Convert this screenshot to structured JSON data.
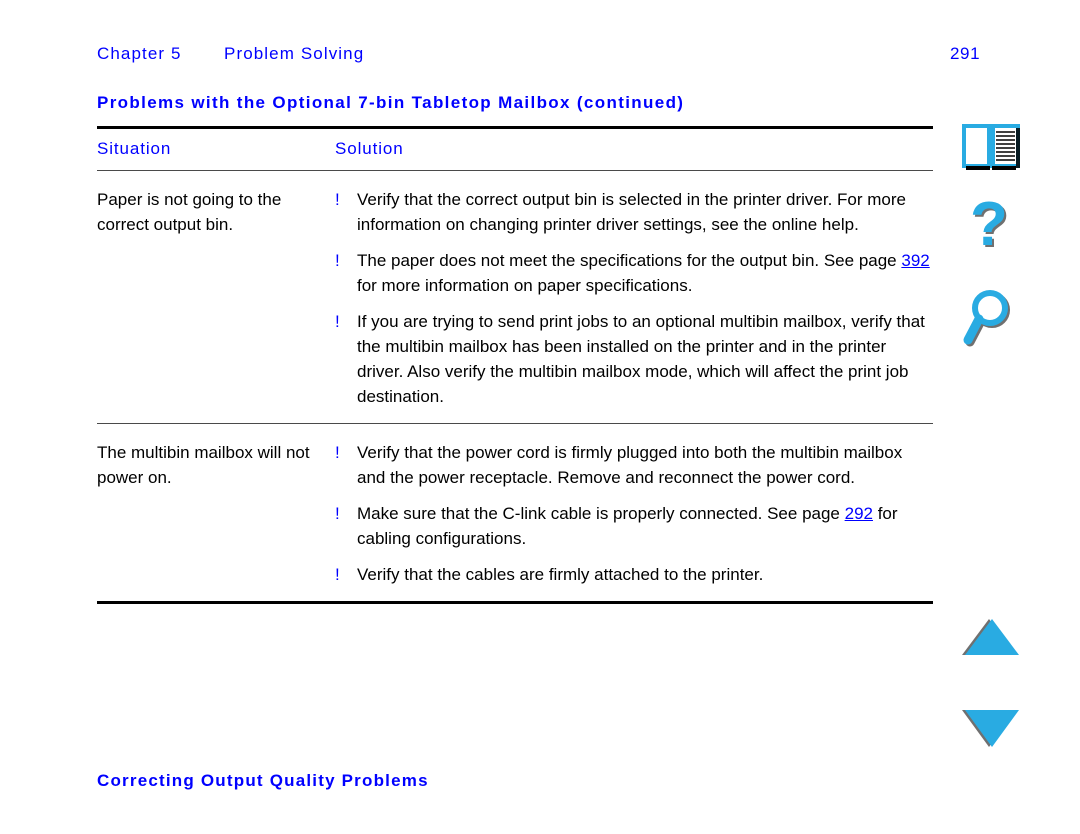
{
  "header": {
    "chapter_label": "Chapter 5",
    "chapter_title": "Problem Solving",
    "page_number": "291"
  },
  "table": {
    "title": "Problems with the Optional 7-bin Tabletop Mailbox (continued)",
    "columns": [
      "Situation",
      "Solution"
    ],
    "rows": [
      {
        "situation": "Paper is not going to the correct output bin.",
        "solutions": [
          {
            "bullet": "!",
            "parts": [
              {
                "type": "text",
                "value": "Verify that the correct output bin is selected in the printer driver. For more information on changing printer driver settings, see the online help."
              }
            ]
          },
          {
            "bullet": "!",
            "parts": [
              {
                "type": "text",
                "value": "The paper does not meet the specifications for the output bin. See page "
              },
              {
                "type": "xref",
                "value": "392"
              },
              {
                "type": "text",
                "value": " for more information on paper specifications."
              }
            ]
          },
          {
            "bullet": "!",
            "parts": [
              {
                "type": "text",
                "value": "If you are trying to send print jobs to an optional multibin mailbox, verify that the multibin mailbox has been installed on the printer and in the printer driver. Also verify the multibin mailbox mode, which will affect the print job destination."
              }
            ]
          }
        ]
      },
      {
        "situation": "The multibin mailbox will not power on.",
        "solutions": [
          {
            "bullet": "!",
            "parts": [
              {
                "type": "text",
                "value": "Verify that the power cord is firmly plugged into both the multibin mailbox and the power receptacle. Remove and reconnect the power cord."
              }
            ]
          },
          {
            "bullet": "!",
            "parts": [
              {
                "type": "text",
                "value": "Make sure that the C-link cable is properly connected. See page "
              },
              {
                "type": "xref",
                "value": "292"
              },
              {
                "type": "text",
                "value": " for cabling configurations."
              }
            ]
          },
          {
            "bullet": "!",
            "parts": [
              {
                "type": "text",
                "value": "Verify that the cables are firmly attached to the printer."
              }
            ]
          }
        ]
      }
    ]
  },
  "footer": {
    "link_label": "Correcting Output Quality Problems"
  },
  "iconrail": {
    "items": [
      {
        "name": "book-icon",
        "tooltip": "Table of Contents"
      },
      {
        "name": "question-mark-icon",
        "tooltip": "Help"
      },
      {
        "name": "magnifier-icon",
        "tooltip": "Find"
      },
      {
        "name": "triangle-up-icon",
        "tooltip": "Previous page"
      },
      {
        "name": "triangle-down-icon",
        "tooltip": "Next page"
      }
    ]
  },
  "colors": {
    "link_blue": "#0000FF",
    "icon_cyan": "#29ABE2",
    "icon_shadow": "#707070",
    "rule_black": "#000000",
    "text_black": "#000000"
  }
}
